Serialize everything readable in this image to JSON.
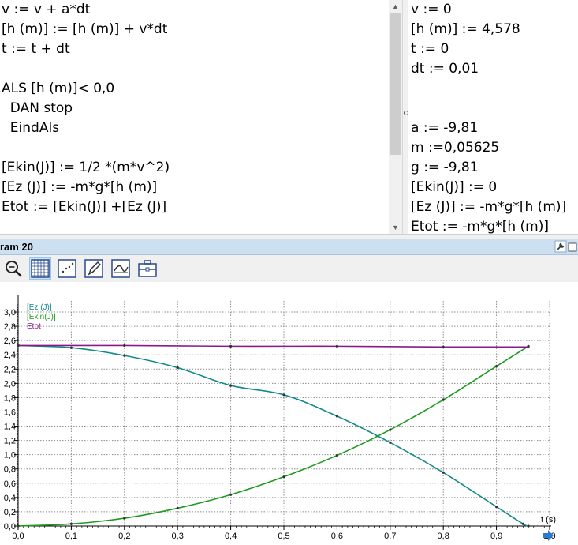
{
  "model": {
    "lines": [
      "v := v + a*dt",
      "[h (m)] := [h (m)] + v*dt",
      "t := t + dt",
      "",
      "ALS [h (m)]< 0,0",
      "  DAN stop",
      "  EindAls",
      "",
      "[Ekin(J)] := 1/2 *(m*v^2)",
      "[Ez (J)] := -m*g*[h (m)]",
      "Etot := [Ekin(J)] +[Ez (J)]"
    ]
  },
  "initial": {
    "lines": [
      "v := 0",
      "[h (m)] := 4,578",
      "t := 0",
      "dt := 0,01",
      "",
      "",
      "a := -9,81",
      "m :=0,05625",
      "g := -9,81",
      "[Ekin(J)] := 0",
      "[Ez (J)] := -m*g*[h (m)]",
      "Etot := -m*g*[h (m)]"
    ]
  },
  "diagram": {
    "title": "ram 20"
  },
  "toolbar": {
    "tools": [
      "zoom-icon",
      "grid-icon",
      "scatter-points-icon",
      "pen-edit-icon",
      "curve-fit-icon",
      "toolbox-icon"
    ]
  },
  "colors": {
    "ez": "#138a8a",
    "ekin": "#1f9a1f",
    "etot": "#8a1a8a",
    "header": "#cde0f2",
    "grid": "#8c8c8c"
  },
  "chart_data": {
    "type": "line",
    "xlabel": "t (s)",
    "ylabel": "",
    "xlim": [
      0,
      1.0
    ],
    "ylim": [
      0,
      3.1
    ],
    "xticks": [
      "0,0",
      "0,1",
      "0,2",
      "0,3",
      "0,4",
      "0,5",
      "0,6",
      "0,7",
      "0,8",
      "0,9",
      "1,0"
    ],
    "yticks": [
      "0,0",
      "0,2",
      "0,4",
      "0,6",
      "0,8",
      "1,0",
      "1,2",
      "1,4",
      "1,6",
      "1,8",
      "2,0",
      "2,2",
      "2,4",
      "2,6",
      "2,8",
      "3,0"
    ],
    "grid": true,
    "legend_position": "top-left",
    "series": [
      {
        "name": "[Ez (J)]",
        "x": [
          0,
          0.1,
          0.2,
          0.3,
          0.4,
          0.5,
          0.6,
          0.7,
          0.8,
          0.9,
          0.95,
          0.96
        ],
        "y": [
          2.53,
          2.5,
          2.39,
          2.22,
          1.97,
          1.84,
          1.54,
          1.17,
          0.75,
          0.27,
          0.03,
          0.0
        ]
      },
      {
        "name": "[Ekin(J)]",
        "x": [
          0,
          0.1,
          0.2,
          0.3,
          0.4,
          0.5,
          0.6,
          0.7,
          0.8,
          0.9,
          0.96
        ],
        "y": [
          0.0,
          0.03,
          0.11,
          0.25,
          0.44,
          0.69,
          0.99,
          1.35,
          1.77,
          2.24,
          2.52
        ]
      },
      {
        "name": "Etot",
        "x": [
          0,
          0.2,
          0.4,
          0.6,
          0.8,
          0.96
        ],
        "y": [
          2.53,
          2.53,
          2.52,
          2.52,
          2.51,
          2.51
        ]
      }
    ]
  }
}
